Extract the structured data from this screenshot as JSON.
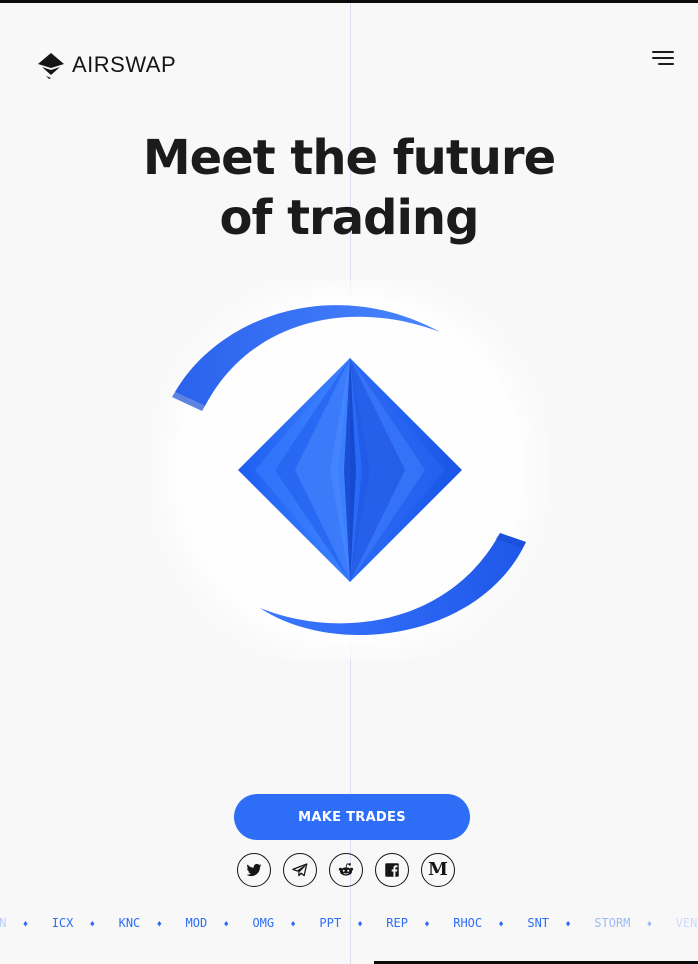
{
  "brand": {
    "name": "AIRSWAP",
    "accent_color": "#2e6df5",
    "logo_icon": "airswap-logo-icon"
  },
  "header": {
    "menu_icon": "hamburger-menu-icon"
  },
  "hero": {
    "headline_line1": "Meet the future",
    "headline_line2": "of trading",
    "illustration_icon": "diamond-swap-illustration"
  },
  "cta": {
    "label": "MAKE TRADES"
  },
  "social": [
    {
      "name": "Twitter",
      "icon": "twitter-icon"
    },
    {
      "name": "Telegram",
      "icon": "telegram-icon"
    },
    {
      "name": "Reddit",
      "icon": "reddit-icon"
    },
    {
      "name": "Facebook",
      "icon": "facebook-icon"
    },
    {
      "name": "Medium",
      "icon": "medium-icon",
      "glyph": "M"
    }
  ],
  "ticker": {
    "separator": "♦",
    "tokens": [
      "CN",
      "ICX",
      "KNC",
      "MOD",
      "OMG",
      "PPT",
      "REP",
      "RHOC",
      "SNT",
      "STORM",
      "VEN"
    ]
  }
}
